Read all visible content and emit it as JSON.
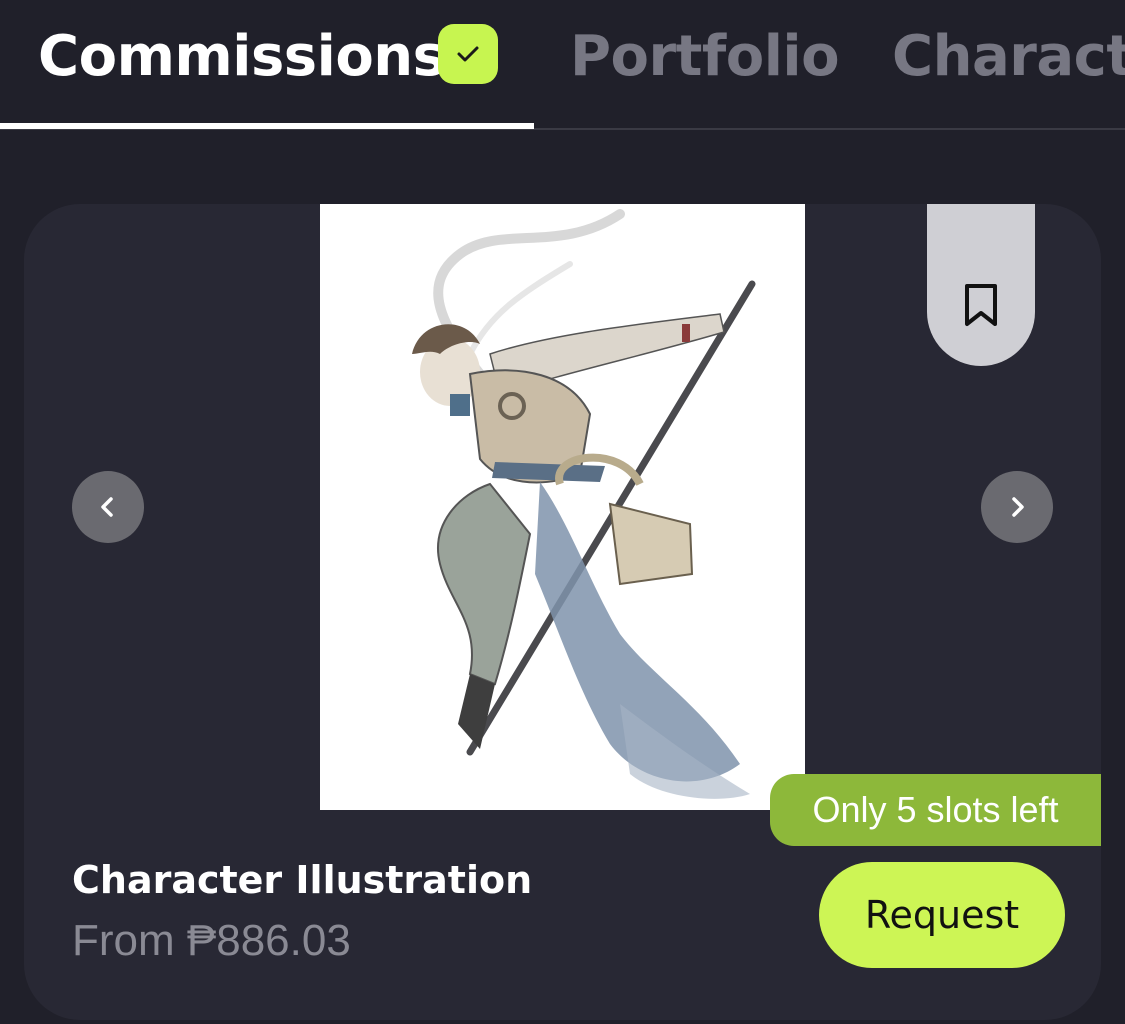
{
  "tabs": [
    {
      "label": "Commissions",
      "active": true,
      "verified": true
    },
    {
      "label": "Portfolio",
      "active": false
    },
    {
      "label": "Characte",
      "active": false
    }
  ],
  "card": {
    "title": "Character Illustration",
    "price": "From ₱886.03",
    "slots_badge": "Only 5 slots left",
    "request_label": "Request"
  },
  "icons": {
    "verified": "check-icon",
    "bookmark": "bookmark-icon",
    "prev": "chevron-left-icon",
    "next": "chevron-right-icon"
  },
  "colors": {
    "background": "#20202a",
    "card": "#282834",
    "accent": "#cdf555",
    "badge": "#8db83a",
    "muted_text": "#777783"
  }
}
